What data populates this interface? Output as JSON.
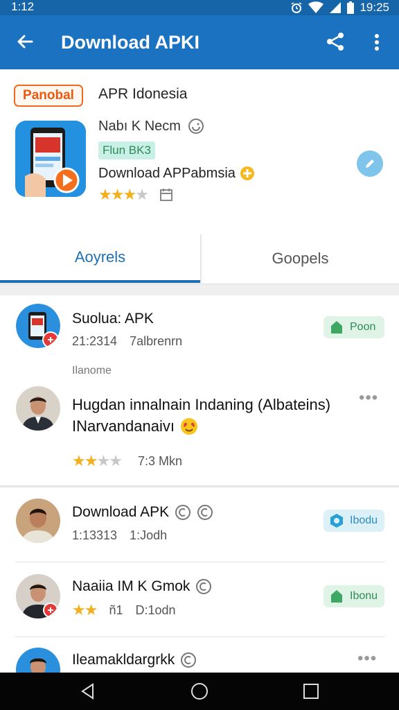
{
  "status_bar": {
    "time_left": "1:12",
    "time_right": "19:25"
  },
  "app_bar": {
    "title": "Download APKI"
  },
  "app_info": {
    "brand_logo_text": "Panobal",
    "app_name": "APR Idonesia",
    "developer": "Nabı K Necm",
    "version_badge": "Flun BK3",
    "subtitle": "Download APPabmsia",
    "rating": 3
  },
  "tabs": [
    {
      "label": "Aoyrels",
      "active": true
    },
    {
      "label": "Goopels",
      "active": false
    }
  ],
  "feed": {
    "item1": {
      "title": "Suolua: APK",
      "meta1": "21:2314",
      "meta2": "7albrenrn",
      "action": "Poon"
    },
    "section_label": "Ilanome",
    "comment": {
      "text_line1": "Hugdan innalnain Indaning (Albateins)",
      "text_line2": "INarvandanaivı",
      "rating": 2,
      "meta": "7:3 Mkn"
    },
    "item2": {
      "title": "Download APK",
      "meta1": "1:13313",
      "meta2": "1:Jodh",
      "action": "Ibodu"
    },
    "item3": {
      "title": "Naaiia IM K Gmok",
      "rating": 2,
      "meta1": "ñ1",
      "meta2": "D:1odn",
      "action": "Ibonu"
    },
    "item4": {
      "title": "Ileamakldargrkk"
    }
  },
  "colors": {
    "status_bar": "#1565a8",
    "app_bar": "#1a72c0",
    "accent": "#1f6fb5",
    "star": "#f2b01e",
    "chip_green": "#2e8b57",
    "chip_blue": "#2a8dbf"
  }
}
